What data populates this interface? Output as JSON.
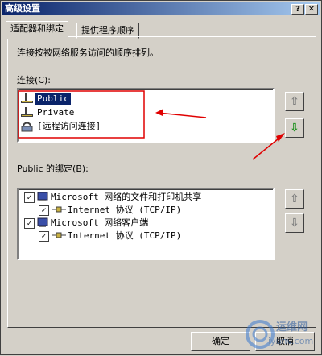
{
  "window": {
    "title": "高级设置"
  },
  "titlebar": {
    "help": "?",
    "close": "✕"
  },
  "tabs": [
    {
      "label": "适配器和绑定"
    },
    {
      "label": "提供程序顺序"
    }
  ],
  "main": {
    "description": "连接按被网络服务访问的顺序排列。",
    "connections_label": "连接(C):",
    "connections": [
      {
        "label": "Public",
        "selected": true,
        "icon": "network-adapter-icon"
      },
      {
        "label": "Private",
        "selected": false,
        "icon": "network-adapter-icon"
      },
      {
        "label": "[远程访问连接]",
        "selected": false,
        "icon": "remote-access-icon"
      }
    ],
    "bindings_label": "Public 的绑定(B):",
    "bindings": [
      {
        "label": "Microsoft 网络的文件和打印机共享",
        "checked": true,
        "indent": 0
      },
      {
        "label": "Internet 协议 (TCP/IP)",
        "checked": true,
        "indent": 1
      },
      {
        "label": "Microsoft 网络客户端",
        "checked": true,
        "indent": 0
      },
      {
        "label": "Internet 协议 (TCP/IP)",
        "checked": true,
        "indent": 1
      }
    ],
    "arrows": {
      "up": "⇧",
      "down": "⇩"
    }
  },
  "footer": {
    "ok": "确定",
    "cancel": "取消"
  },
  "watermark": {
    "text": "运维网",
    "url": "iyunv.com"
  },
  "colors": {
    "annotation": "#e00000",
    "selection": "#0a246a",
    "arrow_green": "#1a8f1a"
  }
}
